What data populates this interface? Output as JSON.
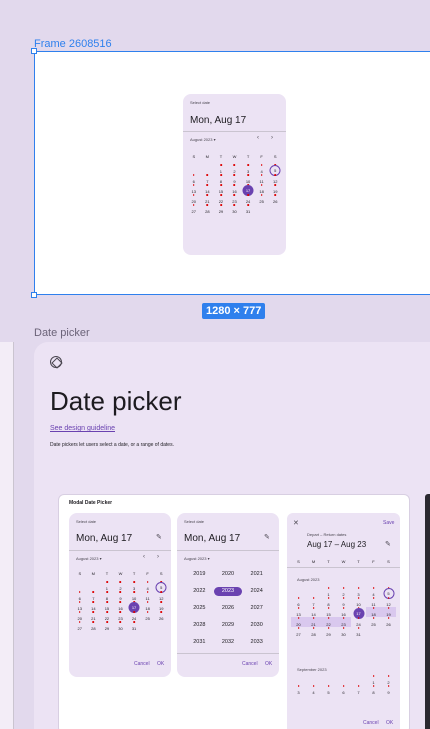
{
  "frame": {
    "label": "Frame 2608516",
    "size_badge": "1280 × 777"
  },
  "weekdays": [
    "S",
    "M",
    "T",
    "W",
    "T",
    "F",
    "S"
  ],
  "frame_picker": {
    "select_label": "Select date",
    "headline": "Mon, Aug 17",
    "month_label": "August 2023",
    "dropdown_glyph": "▾",
    "prev_glyph": "‹",
    "next_glyph": "›",
    "days": [
      "",
      "",
      "1",
      "2",
      "3",
      "4",
      "5",
      "6",
      "7",
      "8",
      "9",
      "10",
      "11",
      "12",
      "13",
      "14",
      "15",
      "16",
      "17",
      "18",
      "19",
      "20",
      "21",
      "22",
      "23",
      "24",
      "25",
      "26",
      "27",
      "28",
      "29",
      "30",
      "31",
      "",
      ""
    ],
    "selected_day": "17",
    "today_day": "5"
  },
  "section": {
    "label": "Date picker",
    "title": "Date picker",
    "link": "See design guideline",
    "description": "Date pickers let users select a date, or a range of dates."
  },
  "showcase": {
    "title": "Modal Date Picker",
    "picker1": {
      "select_label": "Select date",
      "headline": "Mon, Aug 17",
      "edit_glyph": "✎",
      "month_label": "August 2023",
      "dropdown_glyph": "▾",
      "prev_glyph": "‹",
      "next_glyph": "›",
      "cancel": "Cancel",
      "ok": "OK"
    },
    "picker2": {
      "select_label": "Select date",
      "headline": "Mon, Aug 17",
      "edit_glyph": "✎",
      "month_label": "August 2023",
      "dropdown_glyph": "▾",
      "years": [
        "2019",
        "2020",
        "2021",
        "2022",
        "2023",
        "2024",
        "2025",
        "2026",
        "2027",
        "2028",
        "2029",
        "2030",
        "2031",
        "2032",
        "2033"
      ],
      "selected_year": "2023",
      "cancel": "Cancel",
      "ok": "OK"
    },
    "picker3": {
      "close_glyph": "✕",
      "save": "Save",
      "label": "Depart – Return dates",
      "headline": "Aug 17 – Aug 23",
      "edit_glyph": "✎",
      "month1": "August 2023",
      "month2": "September 2023",
      "cancel": "Cancel",
      "ok": "OK"
    }
  }
}
